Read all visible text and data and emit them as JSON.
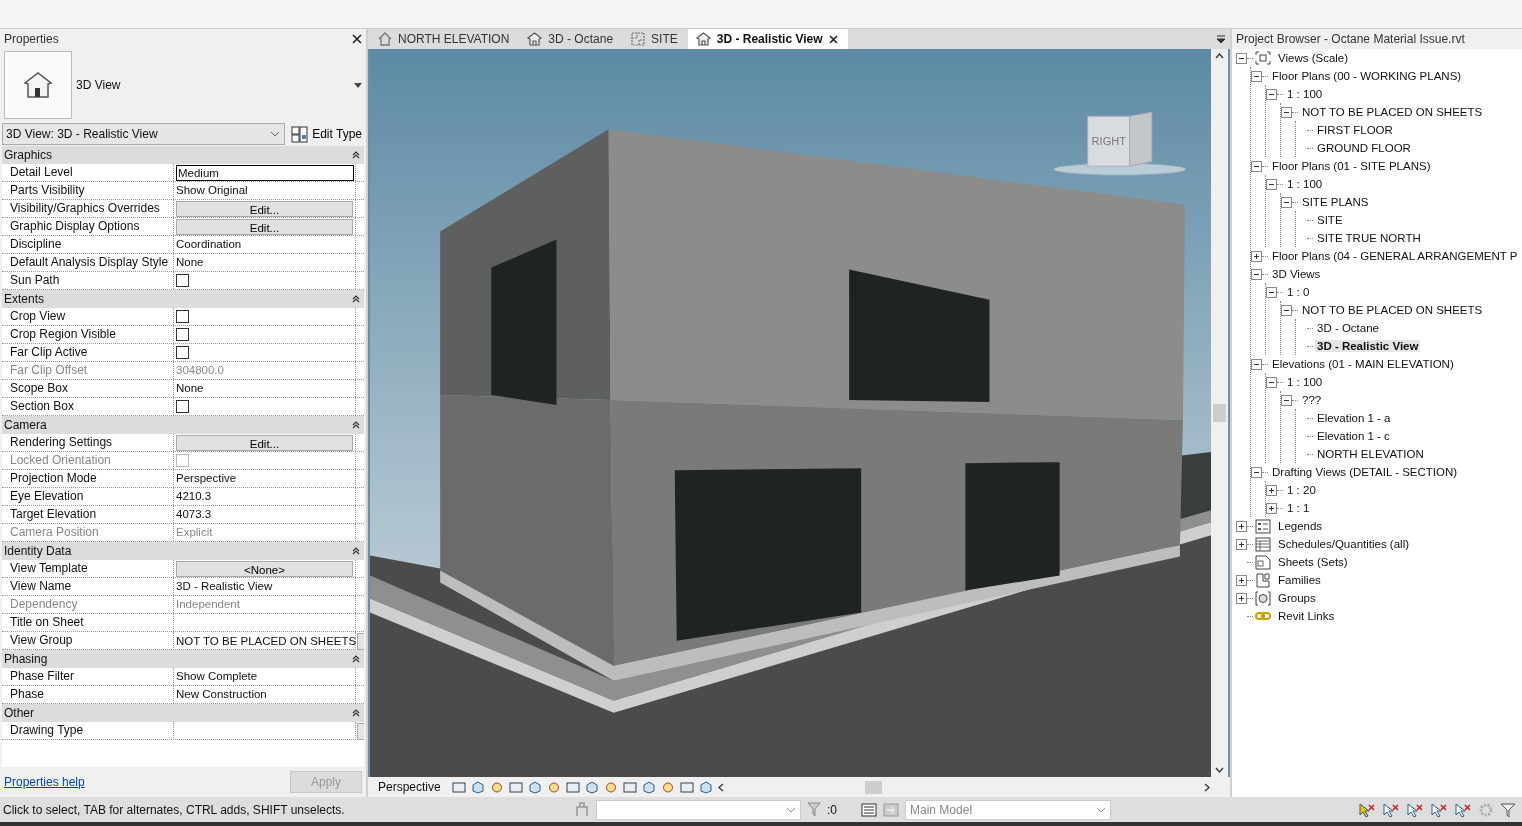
{
  "properties": {
    "title": "Properties",
    "type_name": "3D View",
    "type_selector": "3D View: 3D - Realistic View",
    "edit_type": "Edit Type",
    "groups": [
      {
        "name": "Graphics",
        "rows": [
          {
            "label": "Detail Level",
            "kind": "input",
            "value": "Medium"
          },
          {
            "label": "Parts Visibility",
            "kind": "text",
            "value": "Show Original"
          },
          {
            "label": "Visibility/Graphics Overrides",
            "kind": "button",
            "value": "Edit..."
          },
          {
            "label": "Graphic Display Options",
            "kind": "button",
            "value": "Edit..."
          },
          {
            "label": "Discipline",
            "kind": "text",
            "value": "Coordination"
          },
          {
            "label": "Default Analysis Display Style",
            "kind": "text",
            "value": "None"
          },
          {
            "label": "Sun Path",
            "kind": "checkbox",
            "checked": false
          }
        ]
      },
      {
        "name": "Extents",
        "rows": [
          {
            "label": "Crop View",
            "kind": "checkbox",
            "checked": false
          },
          {
            "label": "Crop Region Visible",
            "kind": "checkbox",
            "checked": false
          },
          {
            "label": "Far Clip Active",
            "kind": "checkbox",
            "checked": false
          },
          {
            "label": "Far Clip Offset",
            "kind": "text",
            "value": "304800.0",
            "disabled": true
          },
          {
            "label": "Scope Box",
            "kind": "text",
            "value": "None"
          },
          {
            "label": "Section Box",
            "kind": "checkbox",
            "checked": false
          }
        ]
      },
      {
        "name": "Camera",
        "rows": [
          {
            "label": "Rendering Settings",
            "kind": "button",
            "value": "Edit..."
          },
          {
            "label": "Locked Orientation",
            "kind": "checkbox",
            "checked": false,
            "disabled": true
          },
          {
            "label": "Projection Mode",
            "kind": "text",
            "value": "Perspective"
          },
          {
            "label": "Eye Elevation",
            "kind": "text",
            "value": "4210.3"
          },
          {
            "label": "Target Elevation",
            "kind": "text",
            "value": "4073.3"
          },
          {
            "label": "Camera Position",
            "kind": "text",
            "value": "Explicit",
            "disabled": true
          }
        ]
      },
      {
        "name": "Identity Data",
        "rows": [
          {
            "label": "View Template",
            "kind": "button",
            "value": "<None>"
          },
          {
            "label": "View Name",
            "kind": "text",
            "value": "3D - Realistic View"
          },
          {
            "label": "Dependency",
            "kind": "text",
            "value": "Independent",
            "disabled": true
          },
          {
            "label": "Title on Sheet",
            "kind": "empty"
          },
          {
            "label": "View Group",
            "kind": "text",
            "value": "NOT TO BE PLACED ON SHEETS",
            "picker": true
          }
        ]
      },
      {
        "name": "Phasing",
        "rows": [
          {
            "label": "Phase Filter",
            "kind": "text",
            "value": "Show Complete"
          },
          {
            "label": "Phase",
            "kind": "text",
            "value": "New Construction"
          }
        ]
      },
      {
        "name": "Other",
        "rows": [
          {
            "label": "Drawing Type",
            "kind": "empty",
            "picker": true
          }
        ]
      }
    ],
    "help_link": "Properties help",
    "apply_button": {
      "label": "Apply",
      "disabled": true
    }
  },
  "view_tabs": [
    {
      "label": "NORTH ELEVATION",
      "kind": "elevation",
      "selected": false
    },
    {
      "label": "3D - Octane",
      "kind": "perspective",
      "selected": false
    },
    {
      "label": "SITE",
      "kind": "plan",
      "selected": false
    },
    {
      "label": "3D - Realistic View",
      "kind": "perspective",
      "selected": true
    }
  ],
  "viewport": {
    "view_cube_label": "RIGHT"
  },
  "view_control_bar": {
    "projection": "Perspective"
  },
  "project_browser": {
    "title": "Project Browser - Octane Material Issue.rvt",
    "tree": [
      {
        "label": "Views (Scale)",
        "kind": "views",
        "expanded": true,
        "selected": false,
        "children": [
          {
            "label": "Floor Plans (00 - WORKING PLANS)",
            "expanded": true,
            "selected": false,
            "children": [
              {
                "label": "1 : 100",
                "expanded": true,
                "selected": false,
                "children": [
                  {
                    "label": "NOT TO BE PLACED ON SHEETS",
                    "expanded": true,
                    "selected": false,
                    "children": [
                      {
                        "label": "FIRST FLOOR",
                        "selected": false
                      },
                      {
                        "label": "GROUND FLOOR",
                        "selected": false
                      }
                    ]
                  }
                ]
              }
            ]
          },
          {
            "label": "Floor Plans (01 - SITE PLANS)",
            "expanded": true,
            "selected": false,
            "children": [
              {
                "label": "1 : 100",
                "expanded": true,
                "selected": false,
                "children": [
                  {
                    "label": "SITE PLANS",
                    "expanded": true,
                    "selected": false,
                    "children": [
                      {
                        "label": "SITE",
                        "selected": false
                      },
                      {
                        "label": "SITE TRUE NORTH",
                        "selected": false
                      }
                    ]
                  }
                ]
              }
            ]
          },
          {
            "label": "Floor Plans (04 - GENERAL ARRANGEMENT P",
            "expanded": false,
            "selected": false
          },
          {
            "label": "3D Views",
            "expanded": true,
            "selected": false,
            "children": [
              {
                "label": "1 : 0",
                "expanded": true,
                "selected": false,
                "children": [
                  {
                    "label": "NOT TO BE PLACED ON SHEETS",
                    "expanded": true,
                    "selected": false,
                    "children": [
                      {
                        "label": "3D - Octane",
                        "selected": false
                      },
                      {
                        "label": "3D - Realistic View",
                        "selected": true
                      }
                    ]
                  }
                ]
              }
            ]
          },
          {
            "label": "Elevations (01 - MAIN ELEVATION)",
            "expanded": true,
            "selected": false,
            "children": [
              {
                "label": "1 : 100",
                "expanded": true,
                "selected": false,
                "children": [
                  {
                    "label": "???",
                    "expanded": true,
                    "selected": false,
                    "children": [
                      {
                        "label": "Elevation 1 - a",
                        "selected": false
                      },
                      {
                        "label": "Elevation 1 - c",
                        "selected": false
                      },
                      {
                        "label": "NORTH ELEVATION",
                        "selected": false
                      }
                    ]
                  }
                ]
              }
            ]
          },
          {
            "label": "Drafting Views (DETAIL - SECTION)",
            "expanded": true,
            "selected": false,
            "children": [
              {
                "label": "1 : 20",
                "expanded": false,
                "selected": false
              },
              {
                "label": "1 : 1",
                "expanded": false,
                "selected": false
              }
            ]
          }
        ]
      },
      {
        "label": "Legends",
        "kind": "legends",
        "expanded": false,
        "selected": false
      },
      {
        "label": "Schedules/Quantities (all)",
        "kind": "schedules",
        "expanded": false,
        "selected": false
      },
      {
        "label": "Sheets (Sets)",
        "kind": "sheets",
        "selected": false
      },
      {
        "label": "Families",
        "kind": "families",
        "expanded": false,
        "selected": false
      },
      {
        "label": "Groups",
        "kind": "groups",
        "expanded": false,
        "selected": false
      },
      {
        "label": "Revit Links",
        "kind": "links",
        "selected": false
      }
    ]
  },
  "status_bar": {
    "message": "Click to select, TAB for alternates, CTRL adds, SHIFT unselects.",
    "filter_count": ":0",
    "workset": "Main Model"
  }
}
